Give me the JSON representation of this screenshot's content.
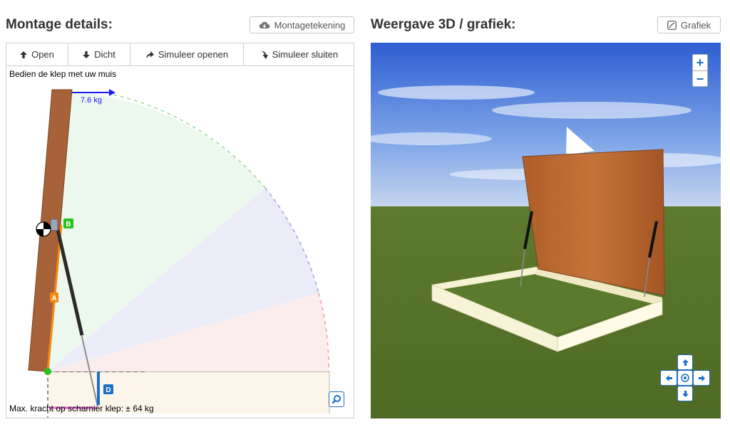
{
  "left": {
    "title": "Montage details:",
    "drawing_button": "Montagetekening",
    "tabs": [
      {
        "label": "Open",
        "icon": "arrow-up-icon"
      },
      {
        "label": "Dicht",
        "icon": "arrow-down-icon"
      },
      {
        "label": "Simuleer openen",
        "icon": "curve-up-arrow-icon"
      },
      {
        "label": "Simuleer sluiten",
        "icon": "curve-down-arrow-icon"
      }
    ],
    "hint": "Bedien de klep met uw muis",
    "weight_label": "7.6 kg",
    "markers": {
      "a": "A",
      "b": "B",
      "d": "D"
    },
    "max_force": "Max. kracht op scharnier klep:  ± 64 kg",
    "colors": {
      "lid": "#a8623a",
      "arm": "#f28a14",
      "force_arrow": "#1a1aff",
      "marker_blue": "#1b6fc9",
      "marker_green": "#27c21b"
    }
  },
  "right": {
    "title": "Weergave 3D / grafiek:",
    "graph_button": "Grafiek",
    "zoom_in": "+",
    "zoom_out": "−",
    "nav_icons": [
      "arrow-up-icon",
      "arrow-left-icon",
      "center-target-icon",
      "arrow-right-icon",
      "arrow-down-icon"
    ]
  }
}
